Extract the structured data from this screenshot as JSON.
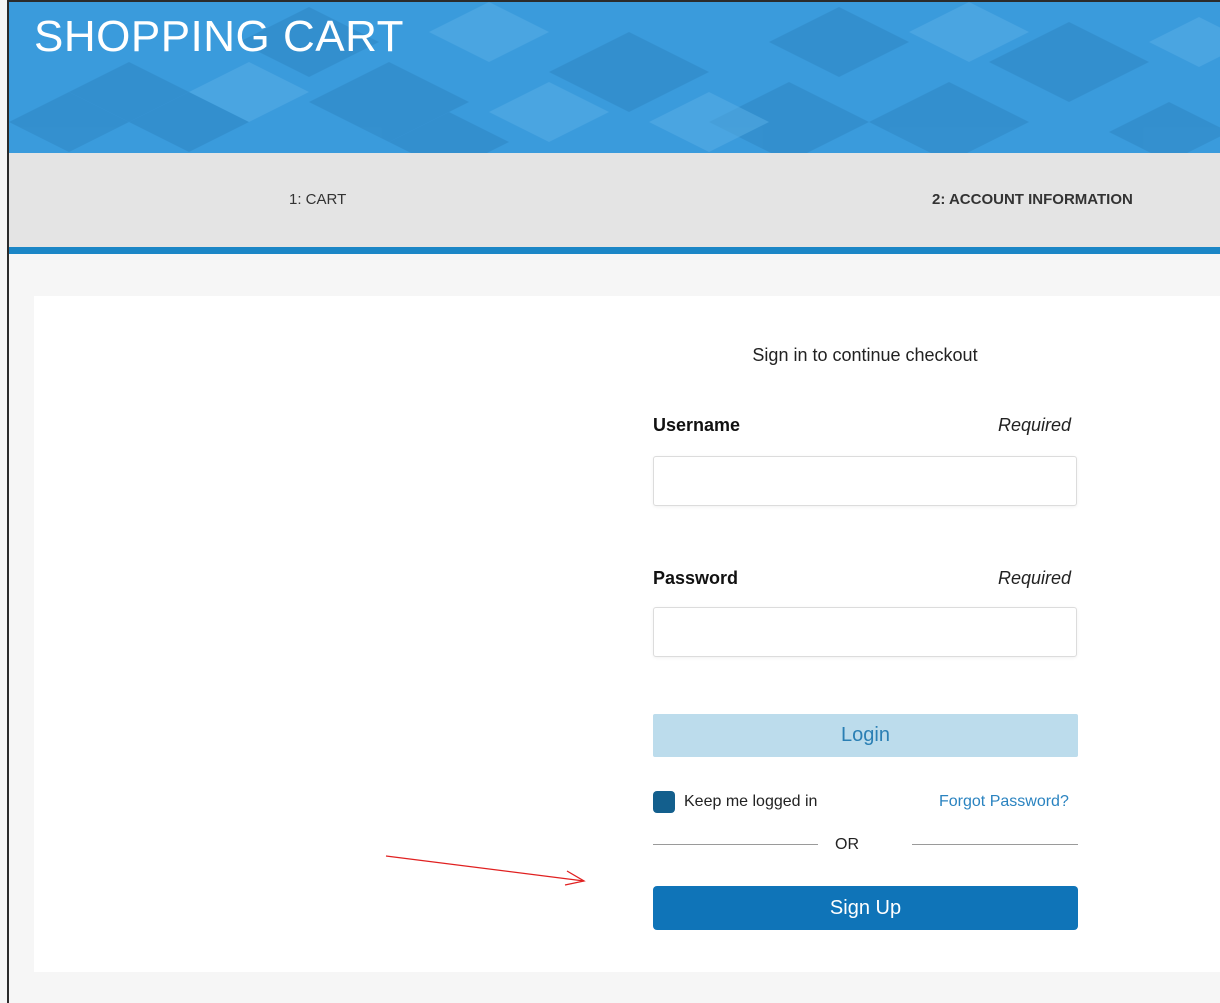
{
  "header": {
    "title": "SHOPPING CART"
  },
  "steps": [
    {
      "label": "1: CART",
      "active": false
    },
    {
      "label": "2: ACCOUNT INFORMATION",
      "active": true
    }
  ],
  "login": {
    "heading": "Sign in to continue checkout",
    "username": {
      "label": "Username",
      "requirement": "Required",
      "value": "",
      "placeholder": ""
    },
    "password": {
      "label": "Password",
      "requirement": "Required",
      "value": "",
      "placeholder": ""
    },
    "login_button": "Login",
    "keep_logged_in": {
      "label": "Keep me logged in",
      "checked": true
    },
    "forgot_password": "Forgot Password?",
    "separator": "OR",
    "signup_button": "Sign Up"
  },
  "annotation": {
    "type": "arrow",
    "color": "#e02020",
    "points_to": "signup-button"
  },
  "colors": {
    "banner": "#3a9bdc",
    "step_bar": "#e4e4e4",
    "step_underline": "#1b86c6",
    "login_button_bg": "#bcdcec",
    "signup_button_bg": "#0f74b8",
    "checkbox": "#135f8d",
    "link": "#2a83c0"
  }
}
